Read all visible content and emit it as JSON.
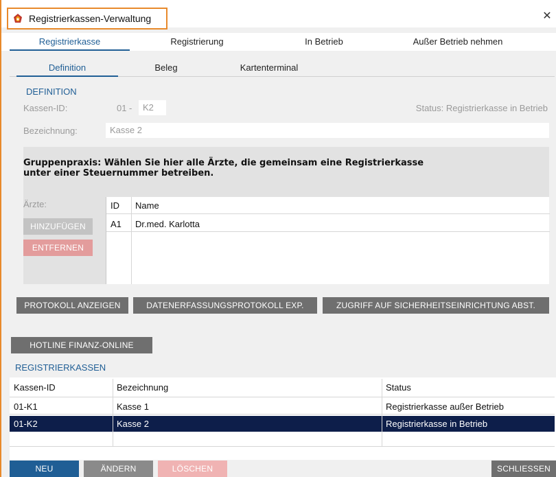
{
  "window": {
    "title": "Registrierkassen-Verwaltung",
    "close_glyph": "✕",
    "accent_color": "#1f5e95",
    "selected_row_color": "#0d1e4a"
  },
  "main_tabs": [
    {
      "label": "Registrierkasse",
      "active": true
    },
    {
      "label": "Registrierung",
      "active": false
    },
    {
      "label": "In Betrieb",
      "active": false
    },
    {
      "label": "Außer Betrieb nehmen",
      "active": false
    }
  ],
  "sub_tabs": [
    {
      "label": "Definition",
      "active": true
    },
    {
      "label": "Beleg",
      "active": false
    },
    {
      "label": "Kartenterminal",
      "active": false
    }
  ],
  "definition": {
    "section_title": "DEFINITION",
    "kassen_id_label": "Kassen-ID:",
    "kassen_id_prefix": "01",
    "kassen_id_separator": "-",
    "kassen_id_value": "K2",
    "status_text": "Status: Registrierkasse in Betrieb",
    "bezeichnung_label": "Bezeichnung:",
    "bezeichnung_value": "Kasse 2",
    "group_note_line1": "Gruppenpraxis: Wählen Sie hier alle Ärzte, die gemeinsam eine Registrierkasse",
    "group_note_line2": "unter einer Steuernummer betreiben.",
    "aerzte_label": "Ärzte:",
    "add_button": "HINZUFÜGEN",
    "remove_button": "ENTFERNEN",
    "aerzte_table": {
      "headers": [
        "ID",
        "Name"
      ],
      "rows": [
        {
          "id": "A1",
          "name": "Dr.med. Karlotta"
        }
      ]
    }
  },
  "actions": {
    "protokoll": "PROTOKOLL ANZEIGEN",
    "datenerfassung": "DATENERFASSUNGSPROTOKOLL EXP.",
    "zugriff": "ZUGRIFF AUF SICHERHEITSEINRICHTUNG ABST.",
    "hotline": "HOTLINE FINANZ-ONLINE"
  },
  "registrierkassen": {
    "section_title": "REGISTRIERKASSEN",
    "headers": [
      "Kassen-ID",
      "Bezeichnung",
      "Status"
    ],
    "rows": [
      {
        "id": "01-K1",
        "name": "Kasse 1",
        "status": "Registrierkasse außer Betrieb",
        "selected": false
      },
      {
        "id": "01-K2",
        "name": "Kasse 2",
        "status": "Registrierkasse in Betrieb",
        "selected": true
      }
    ]
  },
  "footer": {
    "new": "NEU",
    "edit": "ÄNDERN",
    "delete": "LÖSCHEN",
    "close": "SCHLIESSEN"
  }
}
